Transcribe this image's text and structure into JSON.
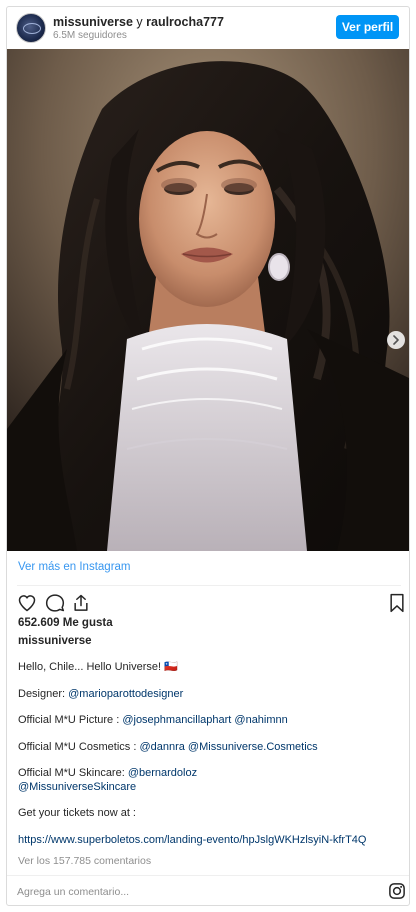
{
  "header": {
    "account": "missuniverse",
    "connector": " y ",
    "collaborator": "raulrocha777",
    "followers": "6.5M seguidores",
    "view_profile": "Ver perfil"
  },
  "media": {
    "description_icon": "photo-portrait",
    "next_icon": "chevron-right-icon"
  },
  "view_more": "Ver más en Instagram",
  "likes": "652.609 Me gusta",
  "username": "missuniverse",
  "caption": {
    "line1": "Hello, Chile... Hello Universe! 🇨🇱",
    "designer_label": "Designer: ",
    "designer_mention": "@marioparottodesigner",
    "picture_label": "Official M*U Picture : ",
    "picture_mention1": "@josephmancillaphart",
    "picture_mention2": "@nahimnn",
    "cosmetics_label": "Official M*U Cosmetics : ",
    "cosmetics_mention1": "@dannra",
    "cosmetics_mention2": "@Missuniverse.Cosmetics",
    "skincare_label": "Official M*U Skincare: ",
    "skincare_mention1": "@bernardoloz",
    "skincare_mention2": "@MissuniverseSkincare",
    "tickets": "Get your tickets now at :",
    "url": "https://www.superboletos.com/landing-evento/hpJslgWKHzlsyiN-kfrT4Q"
  },
  "comments_link": "Ver los 157.785 comentarios",
  "comment_placeholder": "Agrega un comentario...",
  "colors": {
    "primary_button": "#0095f6",
    "link": "#3897f0",
    "mention": "#00376b",
    "muted": "#8e8e8e"
  }
}
